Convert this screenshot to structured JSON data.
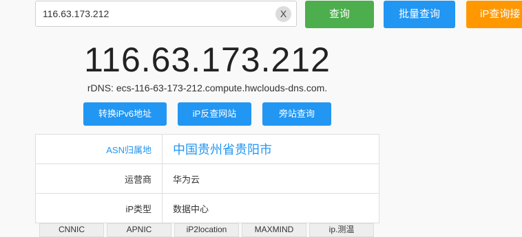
{
  "search": {
    "value": "116.63.173.212",
    "clear_label": "X"
  },
  "top_buttons": {
    "query": "查询",
    "batch_query": "批量查询",
    "ip_api": "iP查询接"
  },
  "colors": {
    "query": "#4cae4c",
    "batch_query": "#2196f3",
    "ip_api": "#ff9800",
    "accent": "#2196f3"
  },
  "result": {
    "ip": "116.63.173.212",
    "rdns": "rDNS: ecs-116-63-173-212.compute.hwclouds-dns.com."
  },
  "actions": {
    "convert_ipv6": "转换iPv6地址",
    "reverse_lookup": "iP反查网站",
    "sibling_sites": "旁站查询"
  },
  "info_rows": [
    {
      "key": "ASN归属地",
      "value": "中国贵州省贵阳市"
    },
    {
      "key": "运营商",
      "value": "华为云"
    },
    {
      "key": "iP类型",
      "value": "数据中心"
    }
  ],
  "source_tabs": [
    "CNNIC",
    "APNIC",
    "iP2location",
    "MAXMIND",
    "ip.测温"
  ]
}
